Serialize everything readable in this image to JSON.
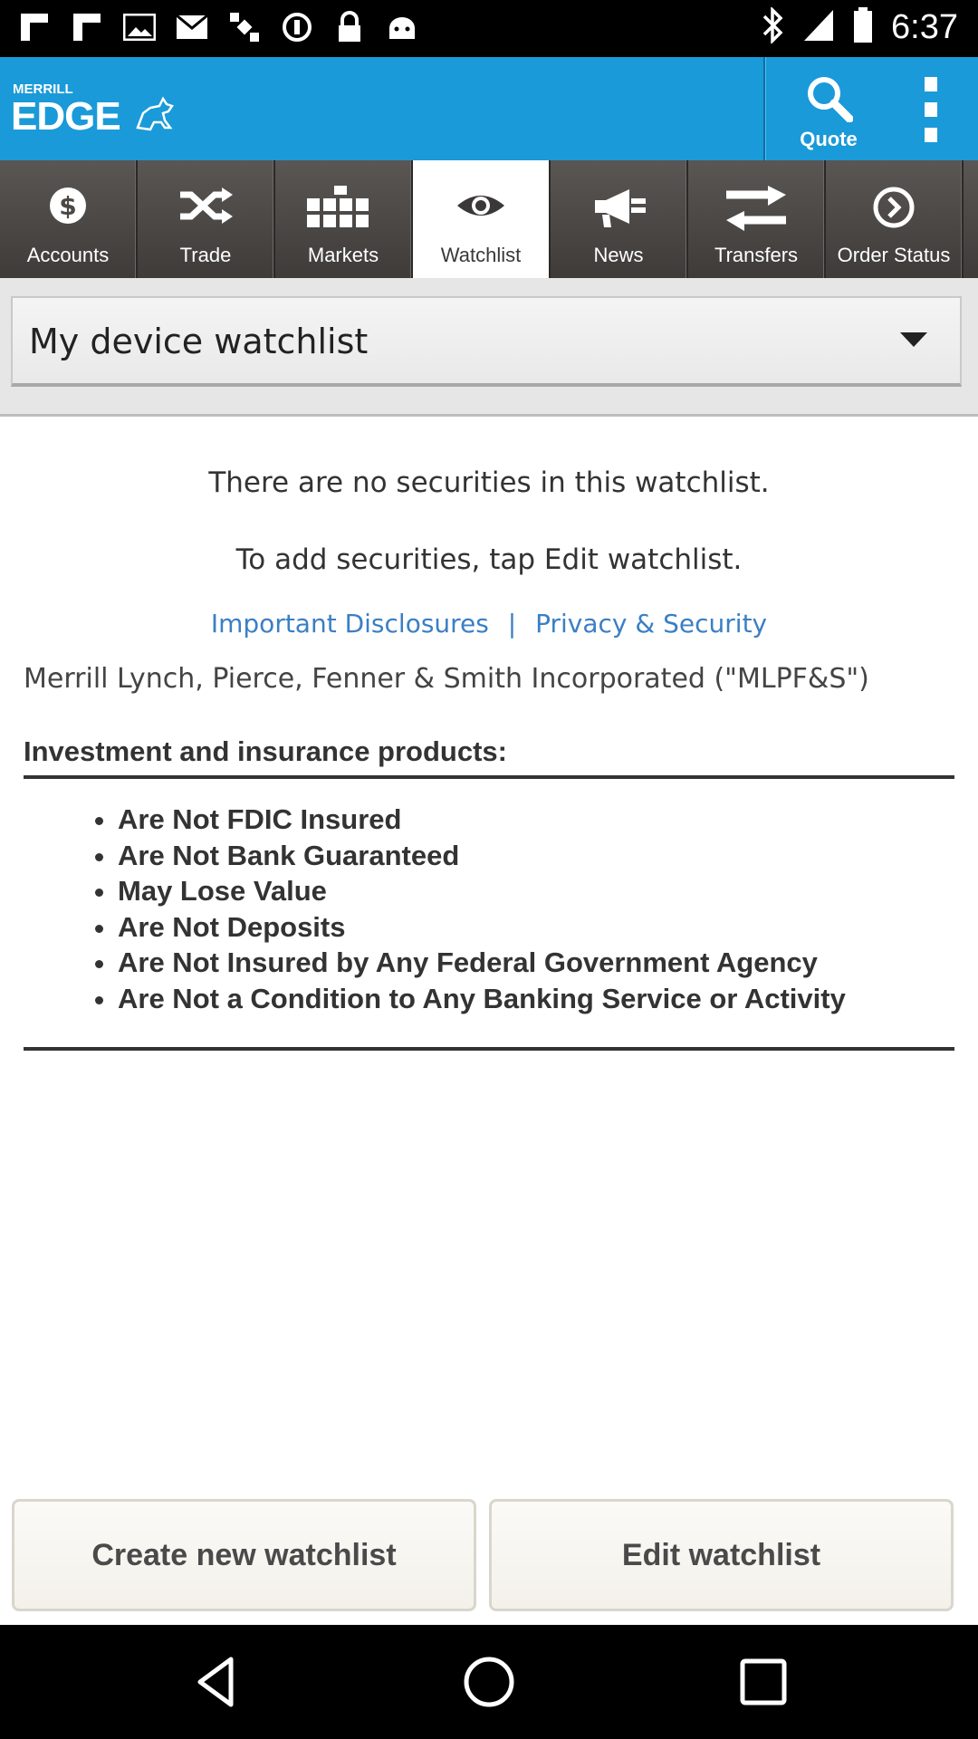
{
  "status_bar": {
    "time": "6:37",
    "left_icons": [
      "flipboard-icon",
      "flipboard-icon",
      "photo-icon",
      "mail-icon",
      "satellite-icon",
      "block-icon",
      "lock-icon",
      "android-icon"
    ],
    "right_icons": [
      "bluetooth-icon",
      "signal-icon",
      "battery-icon"
    ]
  },
  "header": {
    "brand_top": "MERRILL",
    "brand_main": "EDGE",
    "quote_label": "Quote"
  },
  "tabs": [
    {
      "label": "Accounts",
      "icon": "dollar-icon"
    },
    {
      "label": "Trade",
      "icon": "shuffle-icon"
    },
    {
      "label": "Markets",
      "icon": "grid-icon"
    },
    {
      "label": "Watchlist",
      "icon": "eye-icon",
      "active": true
    },
    {
      "label": "News",
      "icon": "megaphone-icon"
    },
    {
      "label": "Transfers",
      "icon": "transfer-icon"
    },
    {
      "label": "Order Status",
      "icon": "chevron-circle-icon"
    }
  ],
  "selector": {
    "value": "My device watchlist"
  },
  "content": {
    "empty_line1": "There are no securities in this watchlist.",
    "empty_line2": "To add securities, tap Edit watchlist.",
    "link_disclosures": "Important Disclosures",
    "link_separator": "|",
    "link_privacy": "Privacy & Security",
    "legal_entity": "Merrill Lynch, Pierce, Fenner & Smith Incorporated (\"MLPF&S\")",
    "disclaimer_heading": "Investment and insurance products:",
    "disclaimer_items": [
      "Are Not FDIC Insured",
      "Are Not Bank Guaranteed",
      "May Lose Value",
      "Are Not Deposits",
      "Are Not Insured by Any Federal Government Agency",
      "Are Not a Condition to Any Banking Service or Activity"
    ]
  },
  "buttons": {
    "create": "Create new watchlist",
    "edit": "Edit watchlist"
  },
  "colors": {
    "header_blue": "#1a9ad8",
    "tab_dark": "#4a4745",
    "link_blue": "#3b7fc4"
  }
}
